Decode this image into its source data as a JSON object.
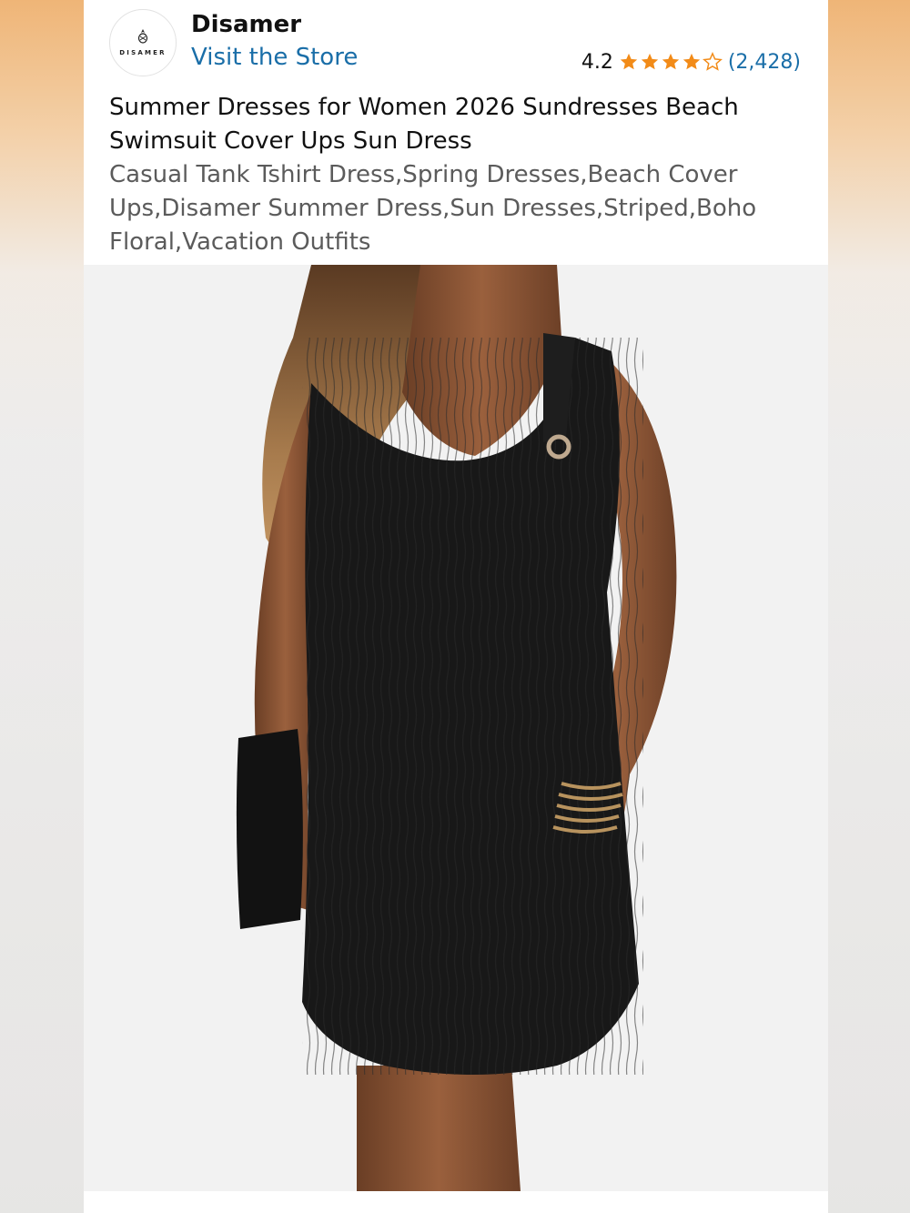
{
  "store": {
    "logo_text": "DISAMER",
    "brand_name": "Disamer",
    "visit_store_label": "Visit the Store"
  },
  "rating": {
    "value": "4.2",
    "stars": 4.2,
    "count": "(2,428)"
  },
  "product": {
    "title": "Summer Dresses for Women 2026 Sundresses Beach Swimsuit Cover Ups Sun Dress",
    "subtitle": "Casual Tank Tshirt Dress,Spring Dresses,Beach Cover Ups,Disamer Summer Dress,Sun Dresses,Striped,Boho Floral,Vacation Outfits",
    "image_icon": "product-photo-black-dress"
  },
  "colors": {
    "link": "#1a6ea8",
    "star": "#f28b18",
    "dress": "#1a1a1a"
  }
}
